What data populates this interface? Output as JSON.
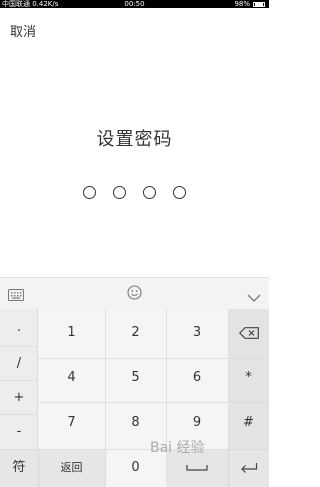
{
  "status_bar": {
    "left": "中国联通 0.42K/s",
    "time": "00:50",
    "battery": "98%"
  },
  "cancel_label": "取消",
  "title": "设置密码",
  "pin": {
    "digits_entered": 0,
    "total_digits": 4
  },
  "keyboard": {
    "toolbar_icons": [
      "keyboard-icon",
      "emoji-icon",
      "chevron-down-icon"
    ],
    "side_keys": [
      ".",
      "/",
      "+",
      "-"
    ],
    "digit_rows": [
      [
        "1",
        "2",
        "3"
      ],
      [
        "4",
        "5",
        "6"
      ],
      [
        "7",
        "8",
        "9"
      ]
    ],
    "right_keys": [
      "delete-icon",
      "*",
      "#"
    ],
    "bottom_row": {
      "symbol": "符",
      "back": "返回",
      "zero": "0",
      "space": "space-icon",
      "enter": "enter-icon"
    }
  },
  "watermark": "Bai 经验"
}
